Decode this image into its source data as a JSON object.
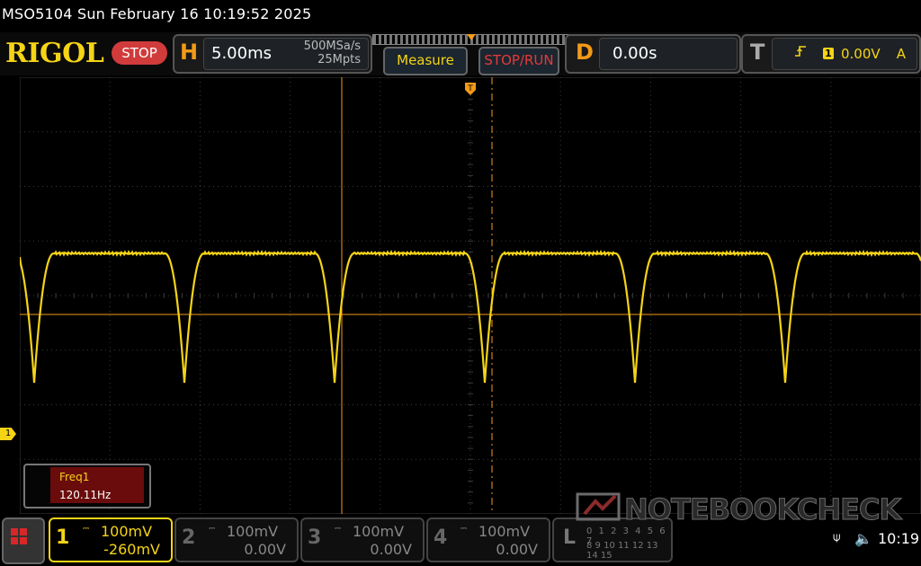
{
  "window": {
    "title": "MSO5104  Sun February 16 10:19:52 2025"
  },
  "brand": {
    "logo": "RIGOL",
    "run_state": "STOP"
  },
  "horizontal": {
    "letter": "H",
    "timebase": "5.00ms",
    "sample_rate": "500MSa/s",
    "memory_depth": "25Mpts"
  },
  "buttons": {
    "measure": "Measure",
    "stop_run": "STOP/RUN",
    "menu_icon": "grid-menu-icon"
  },
  "delay": {
    "letter": "D",
    "value": "0.00s"
  },
  "trigger": {
    "letter": "T",
    "edge_icon": "rising-edge-icon",
    "source": "1",
    "level": "0.00V",
    "mode": "A"
  },
  "trigger_position_marker": "T",
  "measurement": {
    "name": "Freq1",
    "value": "120.11Hz"
  },
  "ch1_marker": "1",
  "channels": [
    {
      "num": "1",
      "coupling_icon": "dc-coupling-icon",
      "coupling": "⎓",
      "scale": "100mV",
      "offset": "-260mV",
      "active": true
    },
    {
      "num": "2",
      "coupling_icon": "dc-coupling-icon",
      "coupling": "⎓",
      "scale": "100mV",
      "offset": "0.00V",
      "active": false
    },
    {
      "num": "3",
      "coupling_icon": "dc-coupling-icon",
      "coupling": "⎓",
      "scale": "100mV",
      "offset": "0.00V",
      "active": false
    },
    {
      "num": "4",
      "coupling_icon": "dc-coupling-icon",
      "coupling": "⎓",
      "scale": "100mV",
      "offset": "0.00V",
      "active": false
    }
  ],
  "logic": {
    "letter": "L",
    "bits_row1": "0 1 2 3 4 5 6 7",
    "bits_row2": "8 9 10 11 12 13 14 15"
  },
  "watermark": {
    "text": "NOTEBOOKCHECK"
  },
  "status": {
    "usb": "⍦",
    "speaker": "🔈",
    "time": "10:19"
  },
  "colors": {
    "ch1": "#f5d416",
    "accent": "#f39a17",
    "stop": "#d13b3b",
    "grid": "#3a3a3a"
  }
}
